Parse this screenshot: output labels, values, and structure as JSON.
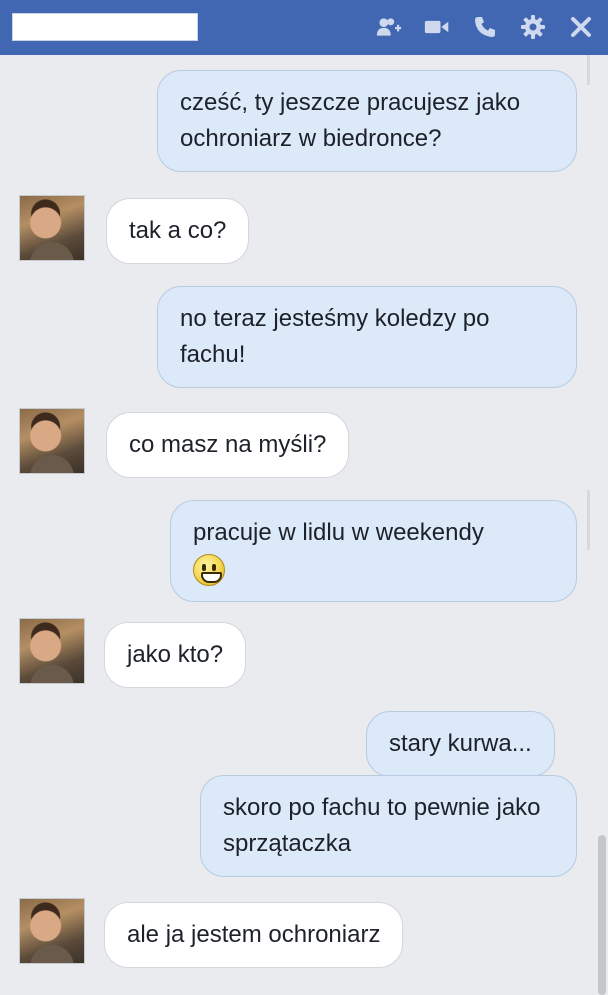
{
  "titlebar": {
    "icons": [
      "add-friend-icon",
      "video-call-icon",
      "phone-icon",
      "gear-icon",
      "close-icon"
    ],
    "color": "#4267b2"
  },
  "messages": [
    {
      "from": "me",
      "text": "cześć, ty jeszcze pracujesz jako ochroniarz w biedronce?"
    },
    {
      "from": "them",
      "text": "tak a co?"
    },
    {
      "from": "me",
      "text": "no teraz jesteśmy koledzy po fachu!"
    },
    {
      "from": "them",
      "text": "co masz na myśli?"
    },
    {
      "from": "me",
      "text": "pracuje w lidlu w weekendy",
      "emoji": "smiley-icon"
    },
    {
      "from": "them",
      "text": "jako kto?"
    },
    {
      "from": "me",
      "text": "stary kurwa..."
    },
    {
      "from": "me",
      "text": "skoro po fachu to pewnie jako sprzątaczka"
    },
    {
      "from": "them",
      "text": "ale ja jestem ochroniarz"
    }
  ],
  "colors": {
    "outgoing_bubble": "#dbe9f9",
    "incoming_bubble": "#ffffff",
    "background": "#e9ebee"
  }
}
